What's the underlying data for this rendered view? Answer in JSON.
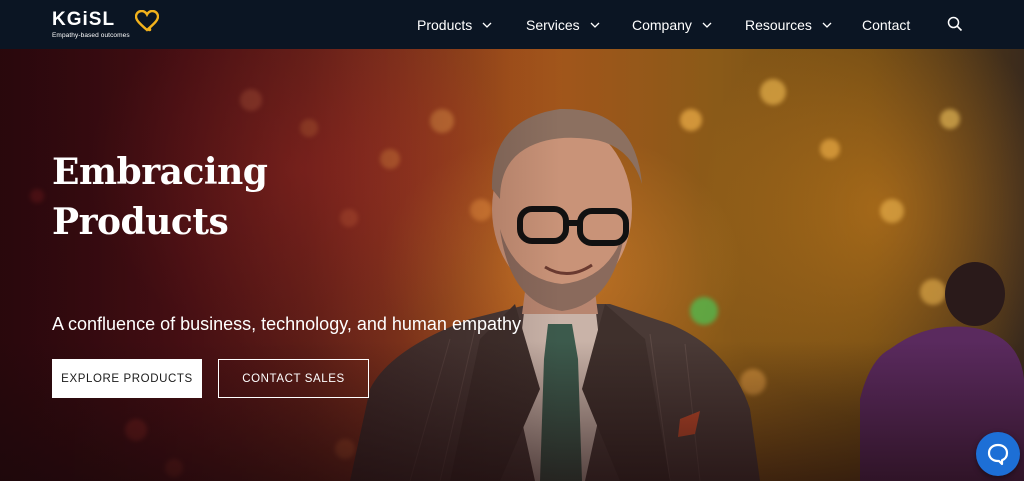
{
  "brand": {
    "name": "KGiSL",
    "tagline": "Empathy-based outcomes",
    "heart_color": "#f2b21c"
  },
  "nav": {
    "items": [
      {
        "label": "Products",
        "has_dropdown": true
      },
      {
        "label": "Services",
        "has_dropdown": true
      },
      {
        "label": "Company",
        "has_dropdown": true
      },
      {
        "label": "Resources",
        "has_dropdown": true
      },
      {
        "label": "Contact",
        "has_dropdown": false
      }
    ],
    "search_icon": "search-icon"
  },
  "hero": {
    "title_line1": "Embracing",
    "title_line2": "Products",
    "subtitle": "A confluence of business, technology, and human empathy",
    "primary_button": "EXPLORE PRODUCTS",
    "secondary_button": "CONTACT SALES"
  },
  "chat": {
    "icon": "chat-bubble-icon",
    "color": "#1d6fd6"
  }
}
